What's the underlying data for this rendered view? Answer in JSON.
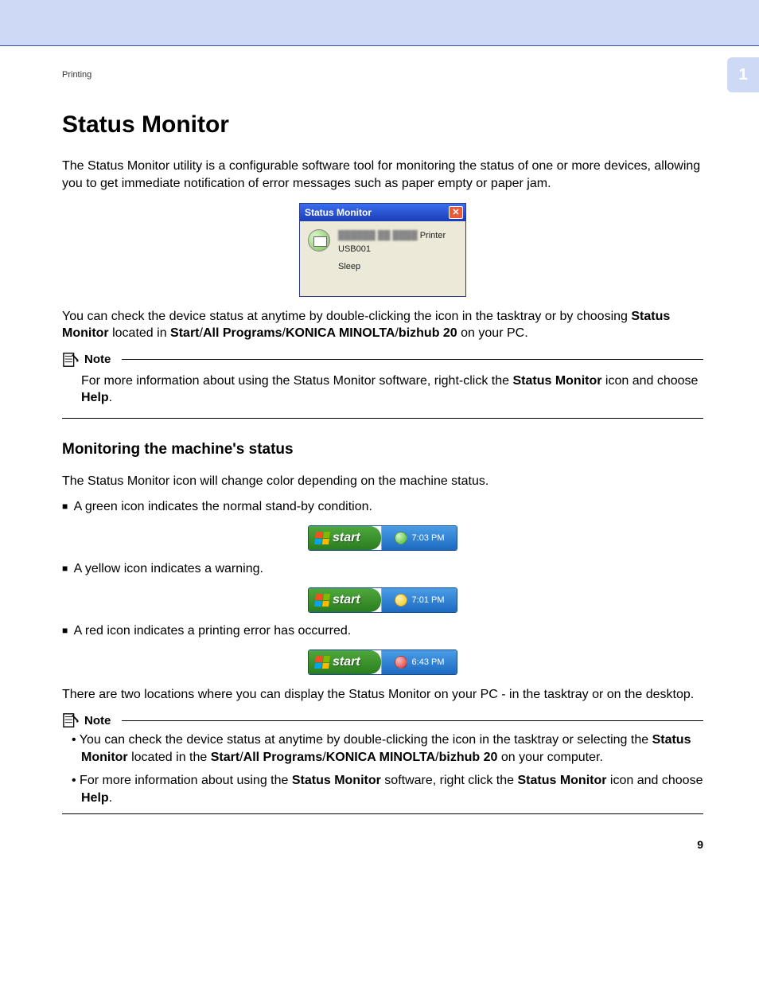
{
  "breadcrumb": "Printing",
  "chapter_tab": "1",
  "page_number": "9",
  "h1": "Status Monitor",
  "intro": "The Status Monitor utility is a configurable software tool for monitoring the status of one or more devices, allowing you to get immediate notification of error messages such as paper empty or paper jam.",
  "status_monitor_window": {
    "title": "Status Monitor",
    "close_glyph": "✕",
    "line1_suffix": "Printer",
    "line2": "USB001",
    "line3": "Sleep"
  },
  "body2_pre": "You can check the device status at anytime by double-clicking the icon in the tasktray or by choosing ",
  "body2_bold1": "Status Monitor",
  "body2_mid": " located in ",
  "body2_bold2": "Start",
  "body2_sep": "/",
  "body2_bold3": "All Programs",
  "body2_bold4": "KONICA MINOLTA",
  "body2_bold5": "bizhub 20",
  "body2_post": " on your PC.",
  "note_label": "Note",
  "note1_pre": "For more information about using the Status Monitor software, right-click the ",
  "note1_bold1": "Status Monitor",
  "note1_mid": " icon and choose ",
  "note1_bold2": "Help",
  "note1_post": ".",
  "h2": "Monitoring the machine's status",
  "h2_intro": "The Status Monitor icon will change color depending on the machine status.",
  "bullet_green": "A green icon indicates the normal stand-by condition.",
  "bullet_yellow": "A yellow icon indicates a warning.",
  "bullet_red": "A red icon indicates a printing error has occurred.",
  "taskbar": {
    "start_label": "start",
    "time_green": "7:03 PM",
    "time_yellow": "7:01 PM",
    "time_red": "6:43 PM"
  },
  "body3": "There are two locations where you can display the Status Monitor on your PC - in the tasktray or on the desktop.",
  "note2_li1_pre": "You can check the device status at anytime by double-clicking the icon in the tasktray or selecting the ",
  "note2_li1_bold1": "Status Monitor",
  "note2_li1_mid": " located in the ",
  "note2_li1_bold2": "Start",
  "note2_li1_bold3": "All Programs",
  "note2_li1_bold4": "KONICA MINOLTA",
  "note2_li1_bold5": "bizhub 20",
  "note2_li1_post": " on your computer.",
  "note2_li2_pre": "For more information about using the ",
  "note2_li2_bold1": "Status Monitor",
  "note2_li2_mid": " software, right click the ",
  "note2_li2_bold2": "Status Monitor",
  "note2_li2_mid2": " icon and choose ",
  "note2_li2_bold3": "Help",
  "note2_li2_post": "."
}
